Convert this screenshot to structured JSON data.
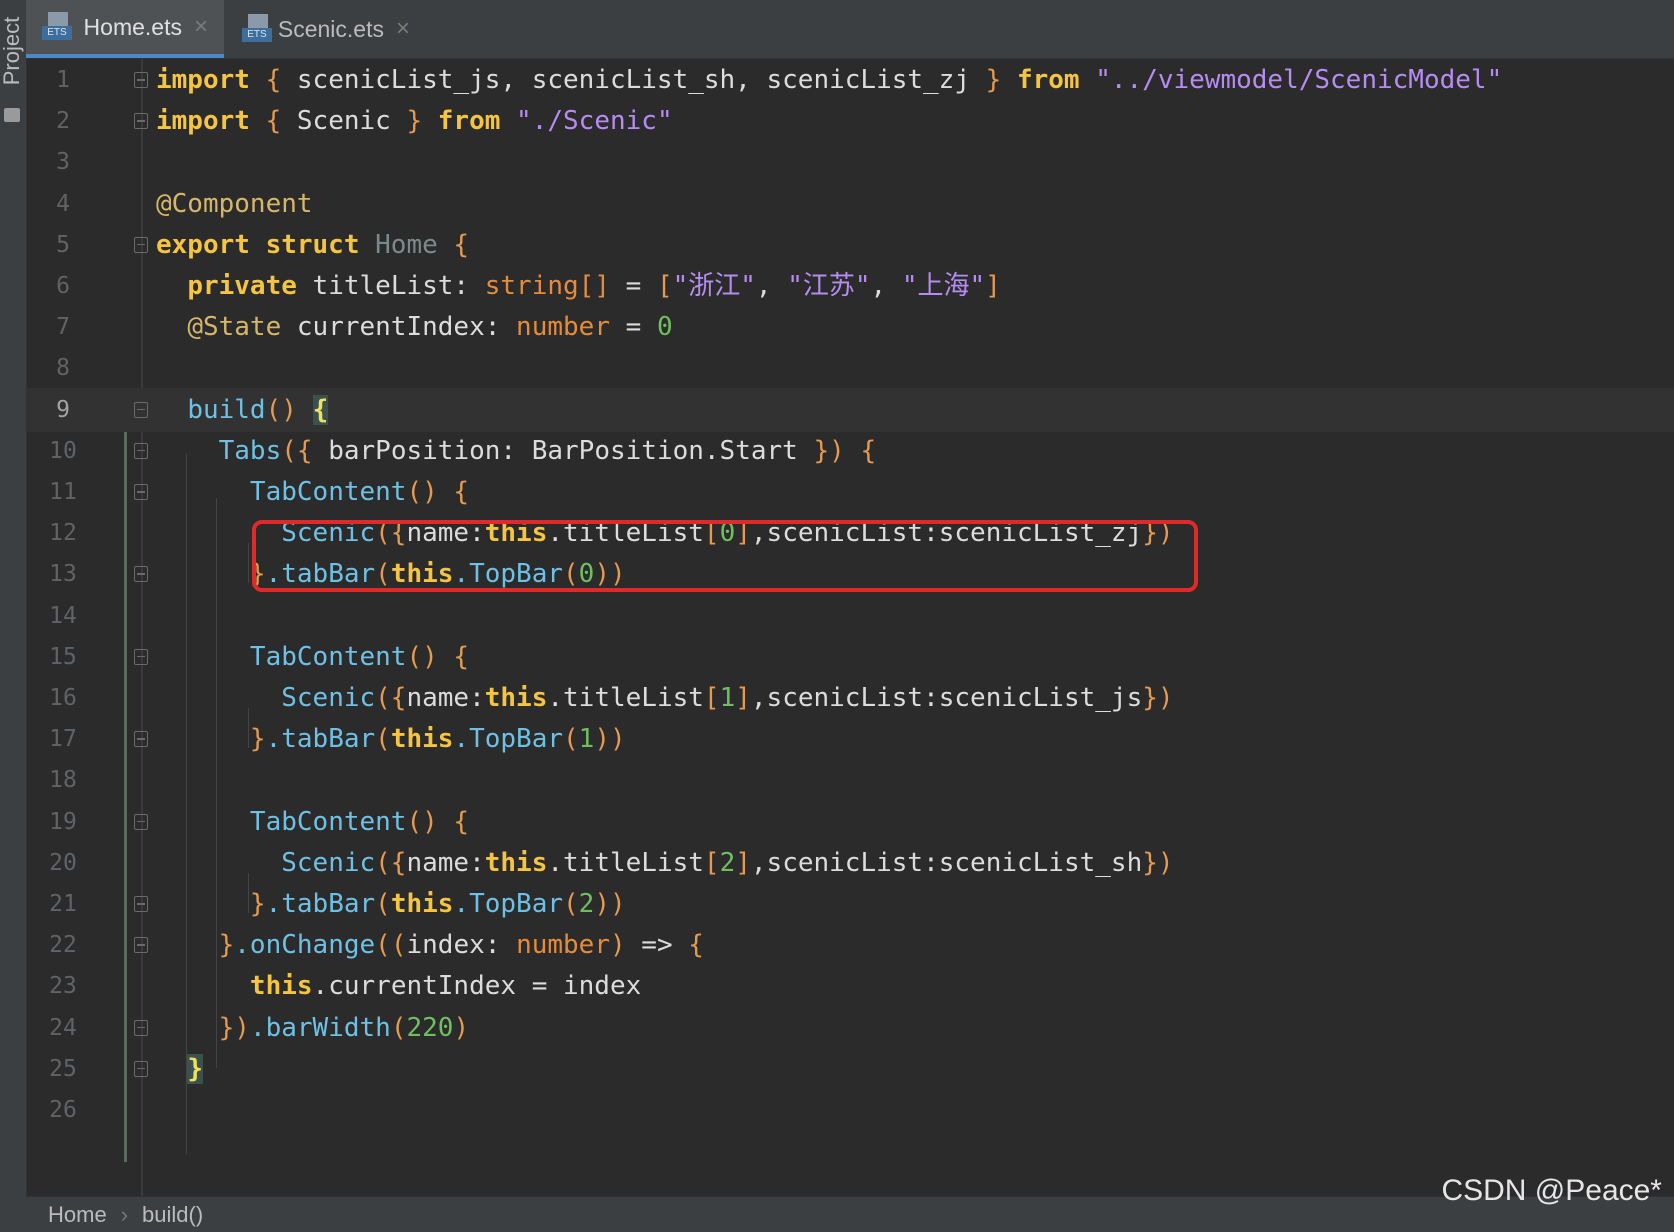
{
  "sidebar": {
    "label": "Project"
  },
  "tabs": [
    {
      "label": "Home.ets",
      "badge": "ETS",
      "active": true
    },
    {
      "label": "Scenic.ets",
      "badge": "ETS",
      "active": false
    }
  ],
  "tab_close_glyph": "×",
  "editor": {
    "current_line": 9,
    "lines": [
      {
        "n": "1",
        "s": [
          [
            "kw",
            "import"
          ],
          [
            "pu",
            " { "
          ],
          [
            "",
            "scenicList_js, scenicList_sh, scenicList_zj"
          ],
          [
            "pu",
            " } "
          ],
          [
            "kw",
            "from"
          ],
          [
            "st",
            " \"../viewmodel/ScenicModel\""
          ]
        ]
      },
      {
        "n": "2",
        "s": [
          [
            "kw",
            "import"
          ],
          [
            "pu",
            " { "
          ],
          [
            "",
            "Scenic"
          ],
          [
            "pu",
            " } "
          ],
          [
            "kw",
            "from"
          ],
          [
            "st",
            " \"./Scenic\""
          ]
        ]
      },
      {
        "n": "3",
        "s": []
      },
      {
        "n": "4",
        "s": [
          [
            "an",
            "@Component"
          ]
        ]
      },
      {
        "n": "5",
        "s": [
          [
            "kw",
            "export struct "
          ],
          [
            "dim",
            "Home"
          ],
          [
            "pu",
            " {"
          ]
        ]
      },
      {
        "n": "6",
        "s": [
          [
            "",
            "  "
          ],
          [
            "kw",
            "private "
          ],
          [
            "",
            "titleList: "
          ],
          [
            "ty",
            "string[]"
          ],
          [
            "",
            " = "
          ],
          [
            "pu",
            "["
          ],
          [
            "st",
            "\"浙江\""
          ],
          [
            "",
            ", "
          ],
          [
            "st",
            "\"江苏\""
          ],
          [
            "",
            ", "
          ],
          [
            "st",
            "\"上海\""
          ],
          [
            "pu",
            "]"
          ]
        ]
      },
      {
        "n": "7",
        "s": [
          [
            "",
            "  "
          ],
          [
            "an",
            "@State "
          ],
          [
            "",
            "currentIndex: "
          ],
          [
            "ty",
            "number"
          ],
          [
            "",
            " = "
          ],
          [
            "nu",
            "0"
          ]
        ]
      },
      {
        "n": "8",
        "s": []
      },
      {
        "n": "9",
        "s": [
          [
            "",
            "  "
          ],
          [
            "id",
            "build"
          ],
          [
            "pu",
            "() "
          ],
          [
            "brace-hl",
            "{"
          ]
        ]
      },
      {
        "n": "10",
        "s": [
          [
            "",
            "    "
          ],
          [
            "id",
            "Tabs"
          ],
          [
            "pu",
            "({ "
          ],
          [
            "",
            "barPosition: BarPosition.Start "
          ],
          [
            "pu",
            "}) {"
          ]
        ]
      },
      {
        "n": "11",
        "s": [
          [
            "",
            "      "
          ],
          [
            "id",
            "TabContent"
          ],
          [
            "pu",
            "() {"
          ]
        ]
      },
      {
        "n": "12",
        "s": [
          [
            "",
            "        "
          ],
          [
            "id",
            "Scenic"
          ],
          [
            "pu",
            "({"
          ],
          [
            "",
            "name:"
          ],
          [
            "kw",
            "this"
          ],
          [
            "",
            ".titleList"
          ],
          [
            "pu",
            "["
          ],
          [
            "nu",
            "0"
          ],
          [
            "pu",
            "]"
          ],
          [
            "",
            ",scenicList:scenicList_zj"
          ],
          [
            "pu",
            "})"
          ]
        ]
      },
      {
        "n": "13",
        "s": [
          [
            "",
            "      "
          ],
          [
            "pu",
            "}"
          ],
          [
            "",
            ""
          ],
          [
            "id",
            ".tabBar"
          ],
          [
            "pu",
            "("
          ],
          [
            "kw",
            "this"
          ],
          [
            "id",
            ".TopBar"
          ],
          [
            "pu",
            "("
          ],
          [
            "nu",
            "0"
          ],
          [
            "pu",
            "))"
          ]
        ]
      },
      {
        "n": "14",
        "s": []
      },
      {
        "n": "15",
        "s": [
          [
            "",
            "      "
          ],
          [
            "id",
            "TabContent"
          ],
          [
            "pu",
            "() {"
          ]
        ]
      },
      {
        "n": "16",
        "s": [
          [
            "",
            "        "
          ],
          [
            "id",
            "Scenic"
          ],
          [
            "pu",
            "({"
          ],
          [
            "",
            "name:"
          ],
          [
            "kw",
            "this"
          ],
          [
            "",
            ".titleList"
          ],
          [
            "pu",
            "["
          ],
          [
            "nu",
            "1"
          ],
          [
            "pu",
            "]"
          ],
          [
            "",
            ",scenicList:scenicList_js"
          ],
          [
            "pu",
            "})"
          ]
        ]
      },
      {
        "n": "17",
        "s": [
          [
            "",
            "      "
          ],
          [
            "pu",
            "}"
          ],
          [
            "id",
            ".tabBar"
          ],
          [
            "pu",
            "("
          ],
          [
            "kw",
            "this"
          ],
          [
            "id",
            ".TopBar"
          ],
          [
            "pu",
            "("
          ],
          [
            "nu",
            "1"
          ],
          [
            "pu",
            "))"
          ]
        ]
      },
      {
        "n": "18",
        "s": []
      },
      {
        "n": "19",
        "s": [
          [
            "",
            "      "
          ],
          [
            "id",
            "TabContent"
          ],
          [
            "pu",
            "() {"
          ]
        ]
      },
      {
        "n": "20",
        "s": [
          [
            "",
            "        "
          ],
          [
            "id",
            "Scenic"
          ],
          [
            "pu",
            "({"
          ],
          [
            "",
            "name:"
          ],
          [
            "kw",
            "this"
          ],
          [
            "",
            ".titleList"
          ],
          [
            "pu",
            "["
          ],
          [
            "nu",
            "2"
          ],
          [
            "pu",
            "]"
          ],
          [
            "",
            ",scenicList:scenicList_sh"
          ],
          [
            "pu",
            "})"
          ]
        ]
      },
      {
        "n": "21",
        "s": [
          [
            "",
            "      "
          ],
          [
            "pu",
            "}"
          ],
          [
            "id",
            ".tabBar"
          ],
          [
            "pu",
            "("
          ],
          [
            "kw",
            "this"
          ],
          [
            "id",
            ".TopBar"
          ],
          [
            "pu",
            "("
          ],
          [
            "nu",
            "2"
          ],
          [
            "pu",
            "))"
          ]
        ]
      },
      {
        "n": "22",
        "s": [
          [
            "",
            "    "
          ],
          [
            "pu",
            "}"
          ],
          [
            "id",
            ".onChange"
          ],
          [
            "pu",
            "(("
          ],
          [
            "",
            "index: "
          ],
          [
            "ty",
            "number"
          ],
          [
            "pu",
            ")"
          ],
          [
            "",
            " => "
          ],
          [
            "pu",
            "{"
          ]
        ]
      },
      {
        "n": "23",
        "s": [
          [
            "",
            "      "
          ],
          [
            "kw",
            "this"
          ],
          [
            "",
            ".currentIndex = index"
          ]
        ]
      },
      {
        "n": "24",
        "s": [
          [
            "",
            "    "
          ],
          [
            "pu",
            "})"
          ],
          [
            "id",
            ".barWidth"
          ],
          [
            "pu",
            "("
          ],
          [
            "nu",
            "220"
          ],
          [
            "pu",
            ")"
          ]
        ]
      },
      {
        "n": "25",
        "s": [
          [
            "",
            "  "
          ],
          [
            "brace-hl",
            "}"
          ]
        ]
      },
      {
        "n": "26",
        "s": []
      }
    ]
  },
  "breadcrumb": {
    "items": [
      "Home",
      "build()"
    ],
    "separator": "›"
  },
  "watermark": "CSDN @Peace*"
}
